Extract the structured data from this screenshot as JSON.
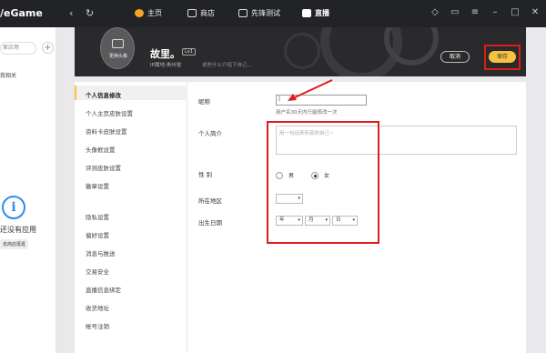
{
  "app": {
    "logo": "/eGame"
  },
  "topbar": {
    "back": "‹",
    "forward": "›",
    "refresh": "↻",
    "tabs": [
      {
        "label": "主页",
        "icon": "game-icon",
        "active": false
      },
      {
        "label": "商店",
        "icon": "store-icon",
        "active": false
      },
      {
        "label": "先锋测试",
        "icon": "test-icon",
        "active": false
      },
      {
        "label": "直播",
        "icon": "live-icon",
        "active": true
      }
    ],
    "window_icons": [
      "skin-icon",
      "message-icon",
      "menu-icon",
      "minimize-icon",
      "maximize-icon",
      "close-icon"
    ]
  },
  "left": {
    "search_placeholder": "家应用",
    "add": "+",
    "mine": "我相关",
    "info_glyph": "i",
    "no_app": "还没有应用",
    "go_store": "去商店逛逛"
  },
  "profile": {
    "avatar_label": "更换头像",
    "name": "故里。",
    "level": "Lv1",
    "ip": "IP属地:贵州省",
    "bio": "说些什么介绍下自己...",
    "cancel": "取消",
    "save": "保存"
  },
  "menu": {
    "items": [
      "个人信息修改",
      "个人主页皮肤设置",
      "资料卡皮肤设置",
      "头像框设置",
      "评测皮肤设置",
      "徽章设置",
      "隐私设置",
      "偏好设置",
      "消息与推送",
      "交易安全",
      "直播信息绑定",
      "收货地址",
      "帐号注销"
    ]
  },
  "form": {
    "nickname_label": "昵称",
    "nickname_value": "|",
    "nickname_hint": "用户名30天内只能修改一次",
    "bio_label": "个人简介",
    "bio_placeholder": "用一句话来形容你自己~",
    "gender_label": "性 别",
    "gender_male": "男",
    "gender_female": "女",
    "gender_selected": "女",
    "region_label": "所在地区",
    "region_value": "",
    "birthday_label": "出生日期",
    "year": "年",
    "month": "月",
    "day": "日"
  },
  "colors": {
    "accent": "#f5c242",
    "highlight": "#e01b1b",
    "link": "#2d8cf0"
  }
}
